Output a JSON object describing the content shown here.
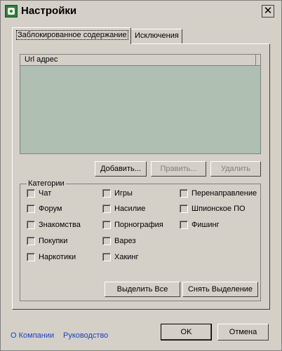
{
  "window": {
    "title": "Настройки"
  },
  "tabs": [
    {
      "label": "Заблокированное содержание"
    },
    {
      "label": "Исключения"
    }
  ],
  "list": {
    "column_header": "Url адрес"
  },
  "buttons": {
    "add": "Добавить...",
    "edit": "Править...",
    "delete": "Удалить",
    "select_all": "Выделить Все",
    "deselect": "Снять Выделение",
    "ok": "OK",
    "cancel": "Отмена"
  },
  "categories": {
    "label": "Категории",
    "items": [
      {
        "label": "Чат",
        "checked": false
      },
      {
        "label": "Форум",
        "checked": false
      },
      {
        "label": "Знакомства",
        "checked": false
      },
      {
        "label": "Покупки",
        "checked": false
      },
      {
        "label": "Наркотики",
        "checked": false
      },
      {
        "label": "Игры",
        "checked": false
      },
      {
        "label": "Насилие",
        "checked": false
      },
      {
        "label": "Порнография",
        "checked": false
      },
      {
        "label": "Варез",
        "checked": false
      },
      {
        "label": "Хакинг",
        "checked": false
      },
      {
        "label": "Перенаправление",
        "checked": false
      },
      {
        "label": "Шпионское ПО",
        "checked": false
      },
      {
        "label": "Фишинг",
        "checked": false
      }
    ]
  },
  "footer": {
    "about_link": "О Компании",
    "manual_link": "Руководство"
  }
}
